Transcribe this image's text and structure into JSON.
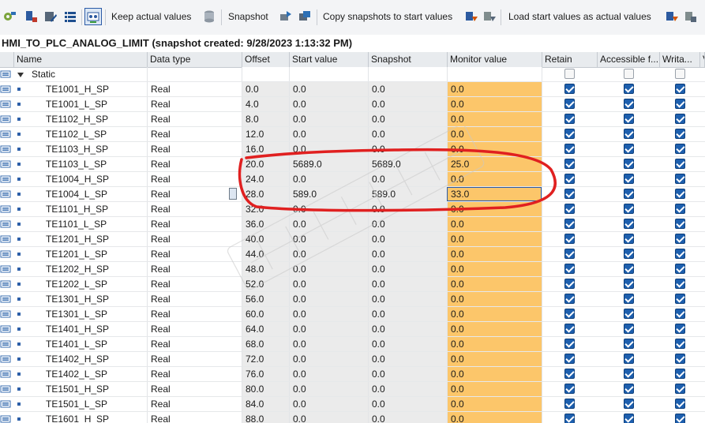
{
  "toolbar": {
    "keep_actual_values": "Keep actual values",
    "snapshot": "Snapshot",
    "copy_snapshots": "Copy snapshots to start values",
    "load_start_values": "Load start values as actual values"
  },
  "title": "HMI_TO_PLC_ANALOG_LIMIT (snapshot created: 9/28/2023 1:13:32 PM)",
  "columns": [
    "Name",
    "Data type",
    "Offset",
    "Start value",
    "Snapshot",
    "Monitor value",
    "Retain",
    "Accessible f...",
    "Writa...",
    "V"
  ],
  "static_label": "Static",
  "rows": [
    {
      "name": "TE1001_H_SP",
      "type": "Real",
      "offset": "0.0",
      "start": "0.0",
      "snapshot": "0.0",
      "monitor": "0.0"
    },
    {
      "name": "TE1001_L_SP",
      "type": "Real",
      "offset": "4.0",
      "start": "0.0",
      "snapshot": "0.0",
      "monitor": "0.0"
    },
    {
      "name": "TE1102_H_SP",
      "type": "Real",
      "offset": "8.0",
      "start": "0.0",
      "snapshot": "0.0",
      "monitor": "0.0"
    },
    {
      "name": "TE1102_L_SP",
      "type": "Real",
      "offset": "12.0",
      "start": "0.0",
      "snapshot": "0.0",
      "monitor": "0.0"
    },
    {
      "name": "TE1103_H_SP",
      "type": "Real",
      "offset": "16.0",
      "start": "0.0",
      "snapshot": "0.0",
      "monitor": "0.0"
    },
    {
      "name": "TE1103_L_SP",
      "type": "Real",
      "offset": "20.0",
      "start": "5689.0",
      "snapshot": "5689.0",
      "monitor": "25.0"
    },
    {
      "name": "TE1004_H_SP",
      "type": "Real",
      "offset": "24.0",
      "start": "0.0",
      "snapshot": "0.0",
      "monitor": "0.0"
    },
    {
      "name": "TE1004_L_SP",
      "type": "Real",
      "offset": "28.0",
      "start": "589.0",
      "snapshot": "589.0",
      "monitor": "33.0"
    },
    {
      "name": "TE1101_H_SP",
      "type": "Real",
      "offset": "32.0",
      "start": "0.0",
      "snapshot": "0.0",
      "monitor": "0.0"
    },
    {
      "name": "TE1101_L_SP",
      "type": "Real",
      "offset": "36.0",
      "start": "0.0",
      "snapshot": "0.0",
      "monitor": "0.0"
    },
    {
      "name": "TE1201_H_SP",
      "type": "Real",
      "offset": "40.0",
      "start": "0.0",
      "snapshot": "0.0",
      "monitor": "0.0"
    },
    {
      "name": "TE1201_L_SP",
      "type": "Real",
      "offset": "44.0",
      "start": "0.0",
      "snapshot": "0.0",
      "monitor": "0.0"
    },
    {
      "name": "TE1202_H_SP",
      "type": "Real",
      "offset": "48.0",
      "start": "0.0",
      "snapshot": "0.0",
      "monitor": "0.0"
    },
    {
      "name": "TE1202_L_SP",
      "type": "Real",
      "offset": "52.0",
      "start": "0.0",
      "snapshot": "0.0",
      "monitor": "0.0"
    },
    {
      "name": "TE1301_H_SP",
      "type": "Real",
      "offset": "56.0",
      "start": "0.0",
      "snapshot": "0.0",
      "monitor": "0.0"
    },
    {
      "name": "TE1301_L_SP",
      "type": "Real",
      "offset": "60.0",
      "start": "0.0",
      "snapshot": "0.0",
      "monitor": "0.0"
    },
    {
      "name": "TE1401_H_SP",
      "type": "Real",
      "offset": "64.0",
      "start": "0.0",
      "snapshot": "0.0",
      "monitor": "0.0"
    },
    {
      "name": "TE1401_L_SP",
      "type": "Real",
      "offset": "68.0",
      "start": "0.0",
      "snapshot": "0.0",
      "monitor": "0.0"
    },
    {
      "name": "TE1402_H_SP",
      "type": "Real",
      "offset": "72.0",
      "start": "0.0",
      "snapshot": "0.0",
      "monitor": "0.0"
    },
    {
      "name": "TE1402_L_SP",
      "type": "Real",
      "offset": "76.0",
      "start": "0.0",
      "snapshot": "0.0",
      "monitor": "0.0"
    },
    {
      "name": "TE1501_H_SP",
      "type": "Real",
      "offset": "80.0",
      "start": "0.0",
      "snapshot": "0.0",
      "monitor": "0.0"
    },
    {
      "name": "TE1501_L_SP",
      "type": "Real",
      "offset": "84.0",
      "start": "0.0",
      "snapshot": "0.0",
      "monitor": "0.0"
    },
    {
      "name": "TE1601_H_SP",
      "type": "Real",
      "offset": "88.0",
      "start": "0.0",
      "snapshot": "0.0",
      "monitor": "0.0"
    }
  ],
  "colors": {
    "monitor_bg": "#fcc66a",
    "readonly_bg": "#ebebeb",
    "checkbox_on": "#1d5fae",
    "annotation": "#e02020"
  },
  "icons": [
    "compile-icon",
    "online-icon",
    "edit-icon",
    "list-icon",
    "monitor-toggle-icon",
    "database-icon",
    "snapshot-icon",
    "copy-icon",
    "load-icon",
    "load-to-device-icon",
    "settings-icon"
  ]
}
